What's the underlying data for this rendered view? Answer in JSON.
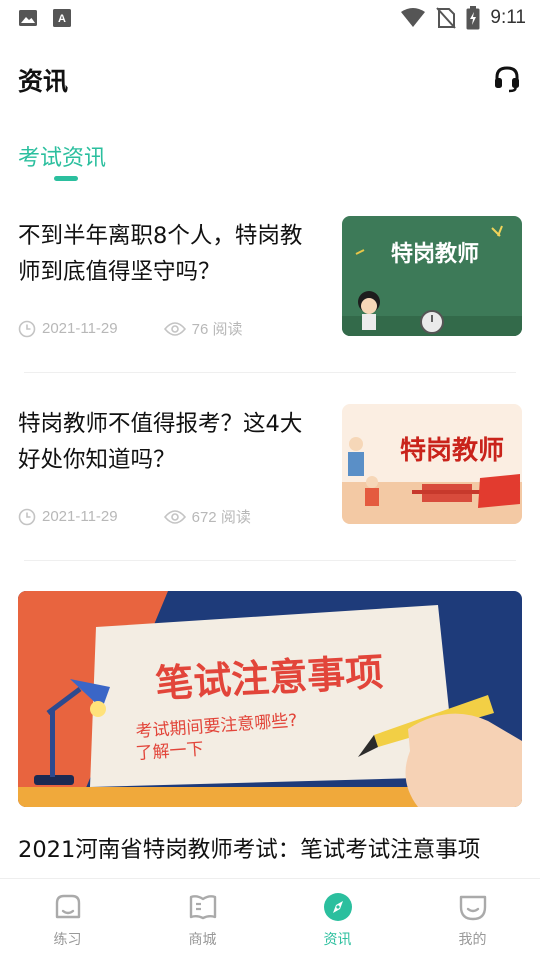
{
  "status_bar": {
    "time": "9:11"
  },
  "header": {
    "title": "资讯"
  },
  "tabs": {
    "active_label": "考试资讯"
  },
  "articles": [
    {
      "title": "不到半年离职8个人，特岗教师到底值得坚守吗？",
      "date": "2021-11-29",
      "views": "76 阅读",
      "thumb_text": "特岗教师"
    },
    {
      "title": "特岗教师不值得报考？这4大好处你知道吗？",
      "date": "2021-11-29",
      "views": "672 阅读",
      "thumb_text": "特岗教师"
    }
  ],
  "banner": {
    "headline": "笔试注意事项",
    "subline1": "考试期间要注意哪些?",
    "subline2": "了解一下"
  },
  "article3": {
    "title": "2021河南省特岗教师考试：笔试考试注意事项"
  },
  "bottom_nav": [
    {
      "label": "练习"
    },
    {
      "label": "商城"
    },
    {
      "label": "资讯"
    },
    {
      "label": "我的"
    }
  ],
  "colors": {
    "accent": "#2bbf9e",
    "text": "#111111",
    "muted": "#b8b8b8"
  }
}
